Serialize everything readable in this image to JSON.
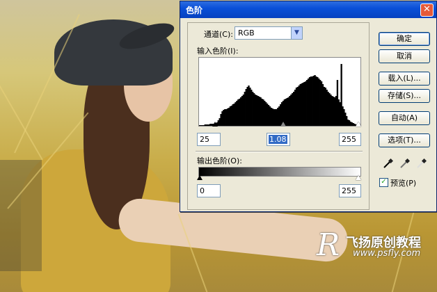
{
  "dialog": {
    "title": "色阶",
    "close_symbol": "✕",
    "channel_label": "通道(C):",
    "channel_value": "RGB",
    "input_levels_label": "输入色阶(I):",
    "input_black": "25",
    "input_gamma": "1.08",
    "input_white": "255",
    "output_levels_label": "输出色阶(O):",
    "output_black": "0",
    "output_white": "255",
    "buttons": {
      "ok": "确定",
      "cancel": "取消",
      "load": "载入(L)...",
      "save": "存储(S)...",
      "auto": "自动(A)",
      "options": "选项(T)..."
    },
    "preview_label": "预览(P)",
    "preview_checked": true,
    "histogram": [
      1,
      1,
      1,
      1,
      2,
      2,
      2,
      2,
      3,
      3,
      3,
      3,
      4,
      5,
      8,
      12,
      18,
      22,
      24,
      25,
      26,
      27,
      28,
      30,
      31,
      33,
      34,
      36,
      38,
      40,
      42,
      44,
      46,
      48,
      52,
      56,
      60,
      62,
      58,
      55,
      52,
      50,
      48,
      47,
      46,
      45,
      44,
      42,
      40,
      38,
      36,
      34,
      32,
      30,
      28,
      27,
      26,
      25,
      26,
      28,
      30,
      33,
      36,
      38,
      40,
      42,
      43,
      44,
      46,
      48,
      50,
      52,
      55,
      58,
      60,
      62,
      64,
      65,
      66,
      67,
      68,
      70,
      72,
      74,
      75,
      76,
      77,
      78,
      76,
      74,
      72,
      70,
      68,
      64,
      60,
      58,
      55,
      52,
      50,
      48,
      46,
      45,
      44,
      46,
      70,
      40,
      36,
      95,
      30,
      25,
      20,
      15,
      10,
      8,
      6,
      5,
      4,
      3,
      2,
      2,
      1,
      1
    ]
  },
  "watermark": {
    "logo": "R",
    "text": "飞扬原创教程",
    "url": "www.psfly.com"
  }
}
